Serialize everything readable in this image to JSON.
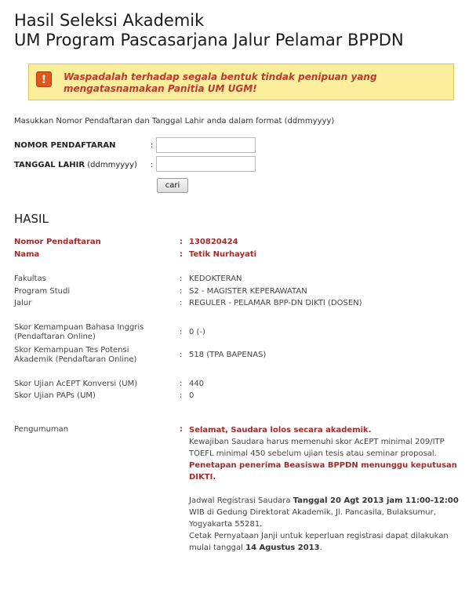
{
  "page": {
    "title_line1": "Hasil Seleksi Akademik",
    "title_line2": "UM Program Pascasarjana Jalur Pelamar BPPDN"
  },
  "warning": {
    "icon": "exclamation-icon",
    "icon_glyph": "!",
    "text": "Waspadalah terhadap segala bentuk tindak penipuan yang mengatasnamakan Panitia UM UGM!",
    "bg_color": "#fbef9e",
    "text_color": "#c0392b"
  },
  "form": {
    "instruction": "Masukkan Nomor Pendaftaran dan Tanggal Lahir anda dalam format (ddmmyyyy)",
    "nomor_label": "NOMOR PENDAFTARAN",
    "tanggal_label": "TANGGAL LAHIR",
    "tanggal_hint": "(ddmmyyyy)",
    "colon": ":",
    "nomor_value": "",
    "tanggal_value": "",
    "submit_label": "cari"
  },
  "hasil": {
    "heading": "HASIL",
    "colon": ":",
    "nomor_label": "Nomor Pendaftaran",
    "nomor_value": "130820424",
    "nama_label": "Nama",
    "nama_value": "Tetik Nurhayati",
    "fakultas_label": "Fakultas",
    "fakultas_value": "KEDOKTERAN",
    "prodi_label": "Program Studi",
    "prodi_value": "S2 - MAGISTER KEPERAWATAN",
    "jalur_label": "Jalur",
    "jalur_value": "REGULER - PELAMAR BPP-DN DIKTI (DOSEN)",
    "inggris_label_1": "Skor Kemampuan Bahasa Inggris",
    "inggris_label_2": "(Pendaftaran Online)",
    "inggris_value": "0 (-)",
    "tpa_label_1": "Skor Kemampuan Tes Potensi",
    "tpa_label_2": "Akademik (Pendaftaran Online)",
    "tpa_value": "518 (TPA BAPENAS)",
    "acept_label": "Skor Ujian AcEPT Konversi (UM)",
    "acept_value": "440",
    "paps_label": "Skor Ujian PAPs (UM)",
    "paps_value": "0",
    "pengumuman_label": "Pengumuman",
    "highlight_color": "#a52a2a"
  },
  "announcement": {
    "headline": "Selamat, Saudara lolos secara akademik.",
    "note": "Kewajiban Saudara harus memenuhi skor AcEPT minimal 209/ITP TOEFL minimal 450 sebelum ujian tesis atau seminar proposal.",
    "beasiswa": "Penetapan penerima Beasiswa BPPDN menunggu keputusan DIKTI.",
    "jadwal_prefix": "Jadwal Registrasi Saudara ",
    "jadwal_date": "Tanggal 20 Agt 2013 jam 11:00-12:00",
    "jadwal_suffix": " WIB di Gedung Direktorat Akademik, Jl. Pancasila, Bulaksumur, Yogyakarta 55281.",
    "cetak_prefix": "Cetak Pernyataan Janji untuk keperluan registrasi dapat dilakukan mulai tanggal ",
    "cetak_date": "14 Agustus 2013",
    "cetak_suffix": "."
  }
}
